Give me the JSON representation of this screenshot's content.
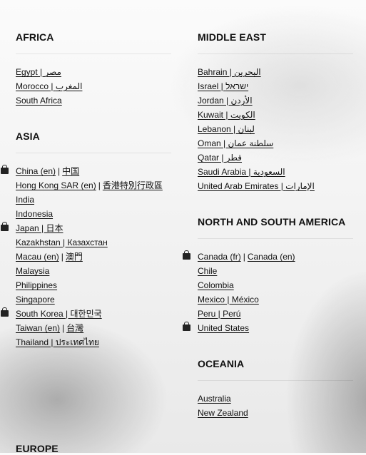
{
  "left": [
    {
      "title": "AFRICA",
      "items": [
        {
          "parts": [
            "Egypt | مصر"
          ],
          "bag": false
        },
        {
          "parts": [
            "Morocco | المغرب"
          ],
          "bag": false
        },
        {
          "parts": [
            "South Africa"
          ],
          "bag": false
        }
      ]
    },
    {
      "title": "ASIA",
      "items": [
        {
          "parts": [
            "China (en)",
            "中国"
          ],
          "bag": true
        },
        {
          "parts": [
            "Hong Kong SAR (en)",
            "香港特別行政區"
          ],
          "bag": false
        },
        {
          "parts": [
            "India"
          ],
          "bag": false
        },
        {
          "parts": [
            "Indonesia"
          ],
          "bag": false
        },
        {
          "parts": [
            "Japan | 日本"
          ],
          "bag": true
        },
        {
          "parts": [
            "Kazakhstan | Казахстан"
          ],
          "bag": false
        },
        {
          "parts": [
            "Macau (en)",
            "澳門"
          ],
          "bag": false
        },
        {
          "parts": [
            "Malaysia"
          ],
          "bag": false
        },
        {
          "parts": [
            "Philippines"
          ],
          "bag": false
        },
        {
          "parts": [
            "Singapore"
          ],
          "bag": false
        },
        {
          "parts": [
            "South Korea | 대한민국"
          ],
          "bag": true
        },
        {
          "parts": [
            "Taiwan (en)",
            "台灣"
          ],
          "bag": false
        },
        {
          "parts": [
            "Thailand | ประเทศไทย"
          ],
          "bag": false
        }
      ]
    },
    {
      "title": "EUROPE",
      "items": []
    }
  ],
  "right": [
    {
      "title": "MIDDLE EAST",
      "items": [
        {
          "parts": [
            "Bahrain | البحرين"
          ],
          "bag": false
        },
        {
          "parts": [
            "Israel | ישראל"
          ],
          "bag": false
        },
        {
          "parts": [
            "Jordan | الأردن"
          ],
          "bag": false
        },
        {
          "parts": [
            "Kuwait | الكويت"
          ],
          "bag": false
        },
        {
          "parts": [
            "Lebanon | لبنان"
          ],
          "bag": false
        },
        {
          "parts": [
            "Oman | سلطنة عمان"
          ],
          "bag": false
        },
        {
          "parts": [
            "Qatar | قطر"
          ],
          "bag": false
        },
        {
          "parts": [
            "Saudi Arabia | السعودية"
          ],
          "bag": false
        },
        {
          "parts": [
            "United Arab Emirates | الإمارات"
          ],
          "bag": false
        }
      ]
    },
    {
      "title": "NORTH AND SOUTH AMERICA",
      "items": [
        {
          "parts": [
            "Canada (fr)",
            "Canada (en)"
          ],
          "bag": true
        },
        {
          "parts": [
            "Chile"
          ],
          "bag": false
        },
        {
          "parts": [
            "Colombia"
          ],
          "bag": false
        },
        {
          "parts": [
            "Mexico | México"
          ],
          "bag": false
        },
        {
          "parts": [
            "Peru | Perú"
          ],
          "bag": false
        },
        {
          "parts": [
            "United States"
          ],
          "bag": true
        }
      ]
    },
    {
      "title": "OCEANIA",
      "items": [
        {
          "parts": [
            "Australia"
          ],
          "bag": false
        },
        {
          "parts": [
            "New Zealand"
          ],
          "bag": false
        }
      ]
    }
  ]
}
